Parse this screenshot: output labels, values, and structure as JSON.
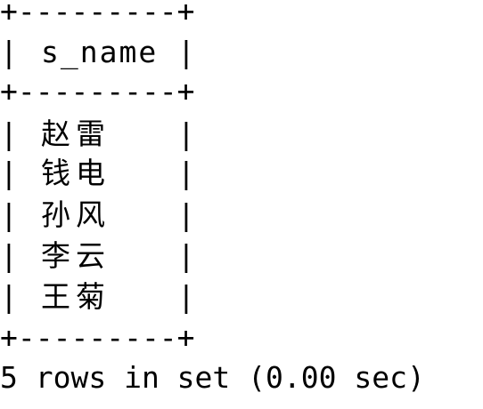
{
  "table": {
    "border_top": "+---------+",
    "header_row_left": "|",
    "header": "s_name",
    "header_row_right": "|",
    "border_mid": "+---------+",
    "rows": [
      {
        "value": "赵雷"
      },
      {
        "value": "钱电"
      },
      {
        "value": "孙风"
      },
      {
        "value": "李云"
      },
      {
        "value": "王菊"
      }
    ],
    "border_bottom": "+---------+"
  },
  "status": "5 rows in set (0.00 sec)"
}
